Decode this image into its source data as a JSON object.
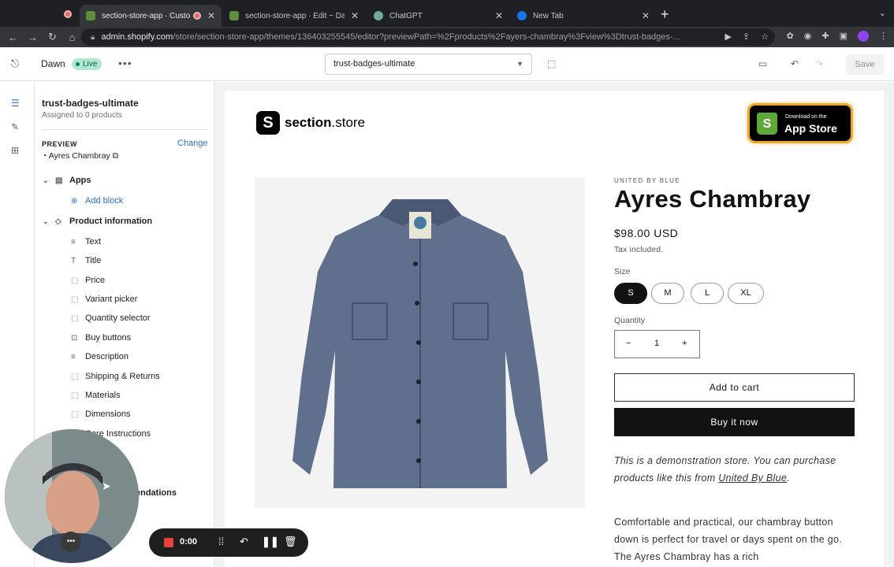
{
  "browser": {
    "tabs": [
      {
        "label": "section-store-app · Custom",
        "favicon_color": "#5e8e3e",
        "active": true
      },
      {
        "label": "section-store-app · Edit ~ Daw",
        "favicon_color": "#5e8e3e",
        "active": false
      },
      {
        "label": "ChatGPT",
        "favicon_color": "#74aa9c",
        "active": false
      },
      {
        "label": "New Tab",
        "favicon_color": "#1a73e8",
        "active": false
      }
    ],
    "url_domain": "admin.shopify.com",
    "url_path": "/store/section-store-app/themes/136403255545/editor?previewPath=%2Fproducts%2Fayers-chambray%3Fview%3Dtrust-badges-..."
  },
  "editor": {
    "theme_name": "Dawn",
    "live_label": "Live",
    "template_select": "trust-badges-ultimate",
    "save_label": "Save"
  },
  "sidebar": {
    "title": "trust-badges-ultimate",
    "subtitle": "Assigned to 0 products",
    "preview_label": "PREVIEW",
    "change_label": "Change",
    "preview_product": "Ayres Chambray",
    "groups": [
      {
        "label": "Apps",
        "add_label": "Add block"
      },
      {
        "label": "Product information"
      }
    ],
    "blocks": [
      "Text",
      "Title",
      "Price",
      "Variant picker",
      "Quantity selector",
      "Buy buttons",
      "Description",
      "Shipping & Returns",
      "Materials",
      "Dimensions",
      "Care Instructions"
    ],
    "partial_item": "endations"
  },
  "store": {
    "logo_letter": "S",
    "logo_bold": "section",
    "logo_rest": ".store",
    "appstore_small": "Download on the",
    "appstore_big": "App Store",
    "vendor": "UNITED BY BLUE",
    "title": "Ayres Chambray",
    "price": "$98.00 USD",
    "tax": "Tax included.",
    "size_label": "Size",
    "sizes": [
      "S",
      "M",
      "L",
      "XL"
    ],
    "selected_size": "S",
    "quantity_label": "Quantity",
    "quantity_value": "1",
    "add_to_cart": "Add to cart",
    "buy_now": "Buy it now",
    "demo_text_1": "This is a demonstration store. You can purchase products like this from ",
    "demo_link": "United By Blue",
    "demo_text_2": ".",
    "description": "Comfortable and practical, our chambray button down is perfect for travel or days spent on the go. The Ayres Chambray has a rich"
  },
  "recorder": {
    "time": "0:00"
  }
}
